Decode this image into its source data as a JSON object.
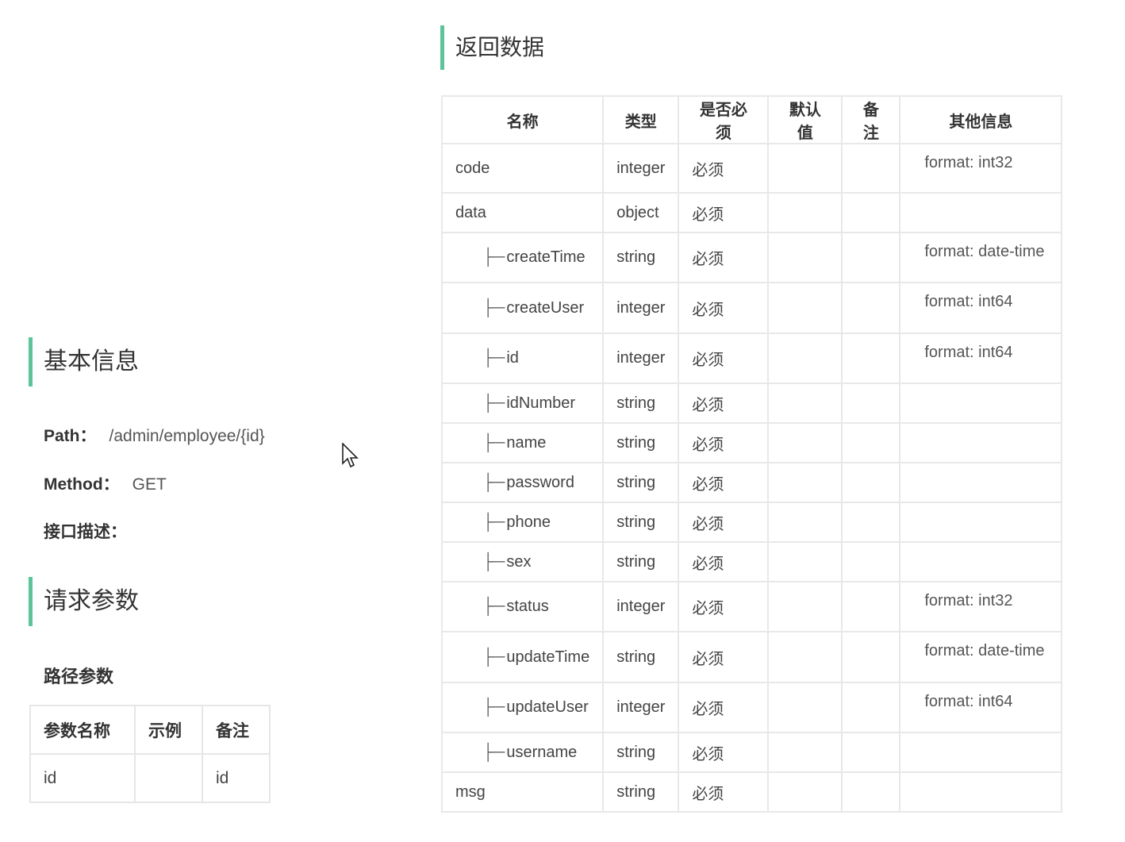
{
  "basic": {
    "title": "基本信息",
    "path_label": "Path：",
    "path_value": "/admin/employee/{id}",
    "method_label": "Method：",
    "method_value": "GET",
    "desc_label": "接口描述："
  },
  "request": {
    "title": "请求参数",
    "path_params_label": "路径参数",
    "headers": [
      "参数名称",
      "示例",
      "备注"
    ],
    "rows": [
      {
        "name": "id",
        "example": "",
        "note": "id"
      }
    ]
  },
  "response": {
    "title": "返回数据",
    "headers": [
      "名称",
      "类型",
      "是否必须",
      "默认值",
      "备注",
      "其他信息"
    ],
    "rows": [
      {
        "name": "code",
        "child": false,
        "type": "integer",
        "required": "必须",
        "default": "",
        "note": "",
        "other": "format: int32"
      },
      {
        "name": "data",
        "child": false,
        "type": "object",
        "required": "必须",
        "default": "",
        "note": "",
        "other": ""
      },
      {
        "name": "createTime",
        "child": true,
        "type": "string",
        "required": "必须",
        "default": "",
        "note": "",
        "other": "format: date-time"
      },
      {
        "name": "createUser",
        "child": true,
        "type": "integer",
        "required": "必须",
        "default": "",
        "note": "",
        "other": "format: int64"
      },
      {
        "name": "id",
        "child": true,
        "type": "integer",
        "required": "必须",
        "default": "",
        "note": "",
        "other": "format: int64"
      },
      {
        "name": "idNumber",
        "child": true,
        "type": "string",
        "required": "必须",
        "default": "",
        "note": "",
        "other": ""
      },
      {
        "name": "name",
        "child": true,
        "type": "string",
        "required": "必须",
        "default": "",
        "note": "",
        "other": ""
      },
      {
        "name": "password",
        "child": true,
        "type": "string",
        "required": "必须",
        "default": "",
        "note": "",
        "other": ""
      },
      {
        "name": "phone",
        "child": true,
        "type": "string",
        "required": "必须",
        "default": "",
        "note": "",
        "other": ""
      },
      {
        "name": "sex",
        "child": true,
        "type": "string",
        "required": "必须",
        "default": "",
        "note": "",
        "other": ""
      },
      {
        "name": "status",
        "child": true,
        "type": "integer",
        "required": "必须",
        "default": "",
        "note": "",
        "other": "format: int32"
      },
      {
        "name": "updateTime",
        "child": true,
        "type": "string",
        "required": "必须",
        "default": "",
        "note": "",
        "other": "format: date-time"
      },
      {
        "name": "updateUser",
        "child": true,
        "type": "integer",
        "required": "必须",
        "default": "",
        "note": "",
        "other": "format: int64"
      },
      {
        "name": "username",
        "child": true,
        "type": "string",
        "required": "必须",
        "default": "",
        "note": "",
        "other": ""
      },
      {
        "name": "msg",
        "child": false,
        "type": "string",
        "required": "必须",
        "default": "",
        "note": "",
        "other": ""
      }
    ]
  },
  "colors": {
    "accent": "#5cc39b",
    "border": "#e8e8e8"
  }
}
